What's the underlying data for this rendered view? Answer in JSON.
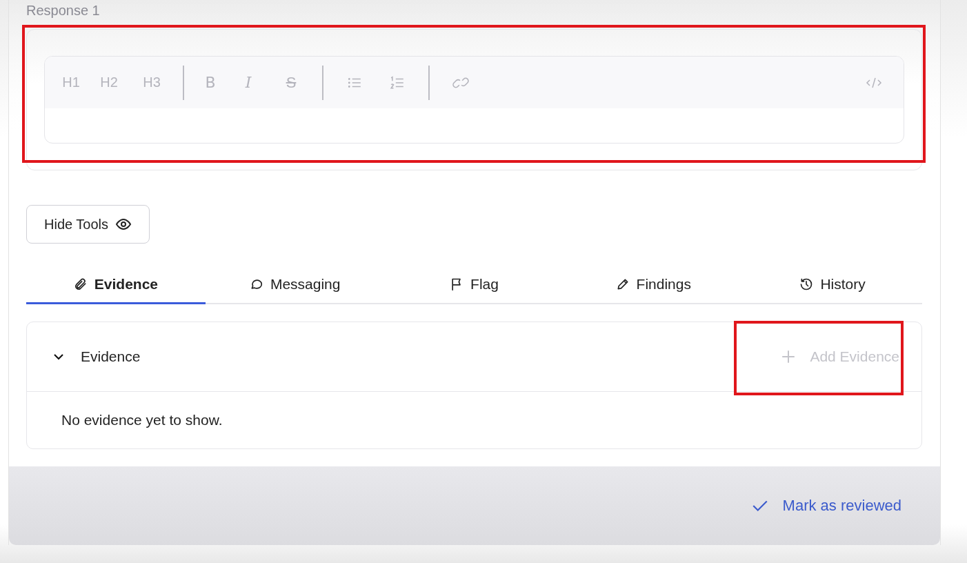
{
  "section_label": "Response 1",
  "editor": {
    "toolbar_groups": [
      [
        {
          "kind": "heading",
          "label": "H1"
        },
        {
          "kind": "heading",
          "label": "H2"
        },
        {
          "kind": "heading",
          "label": "H3"
        }
      ],
      [
        {
          "kind": "bold",
          "label": "B"
        },
        {
          "kind": "italic",
          "label": "I"
        },
        {
          "kind": "strike",
          "label": "S"
        }
      ],
      [
        {
          "kind": "bullet-list"
        },
        {
          "kind": "numbered-list"
        }
      ],
      [
        {
          "kind": "link"
        }
      ]
    ],
    "toolbar_right": [
      {
        "kind": "code"
      }
    ],
    "disabled": true
  },
  "hide_tools_button": {
    "label": "Hide Tools"
  },
  "tabs": [
    {
      "label": "Evidence",
      "selected": true
    },
    {
      "label": "Messaging",
      "selected": false
    },
    {
      "label": "Flag",
      "selected": false
    },
    {
      "label": "Findings",
      "selected": false
    },
    {
      "label": "History",
      "selected": false
    }
  ],
  "evidence_panel": {
    "title": "Evidence",
    "expanded": true,
    "add_button": {
      "label": "Add Evidence",
      "disabled": true
    },
    "empty_text": "No evidence yet to show."
  },
  "footer": {
    "action": {
      "label": "Mark as reviewed"
    }
  },
  "annotations": [
    {
      "kind": "rect"
    },
    {
      "kind": "rect"
    }
  ]
}
